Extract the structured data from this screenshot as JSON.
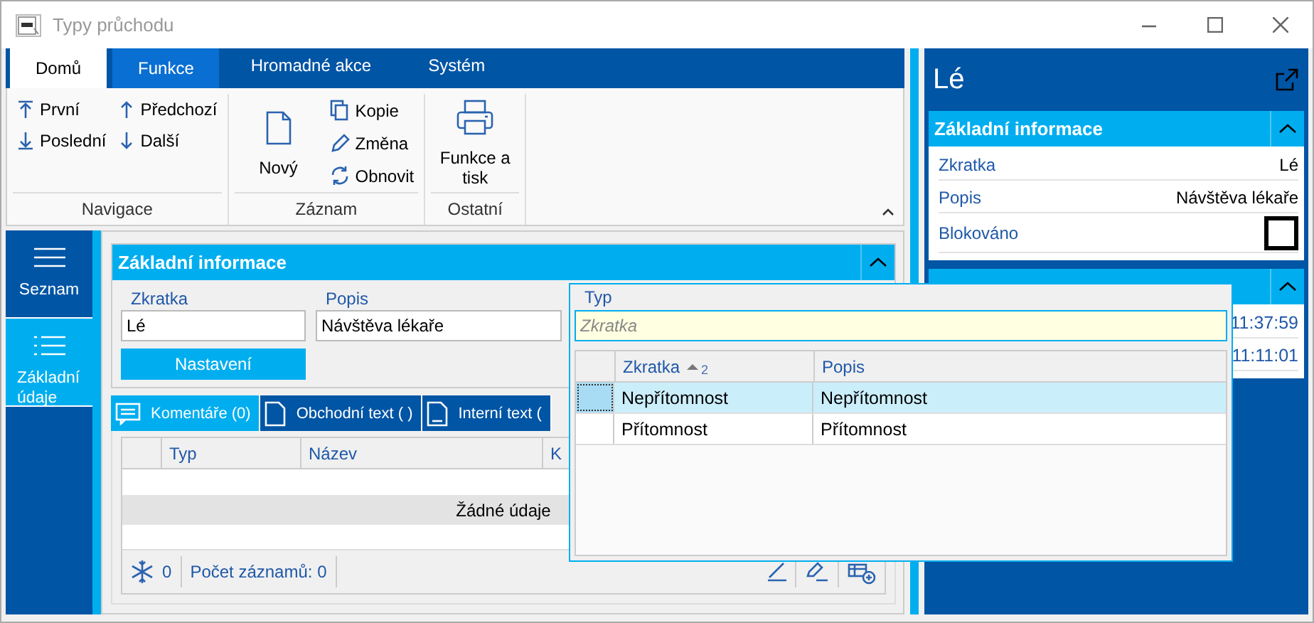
{
  "window": {
    "title": "Typy průchodu"
  },
  "ribbon": {
    "tabs": [
      {
        "label": "Domů",
        "selected": true,
        "kind": "normal"
      },
      {
        "label": "Funkce",
        "selected": false,
        "kind": "contextual"
      },
      {
        "label": "Hromadné akce",
        "selected": false,
        "kind": "normal"
      },
      {
        "label": "Systém",
        "selected": false,
        "kind": "normal"
      }
    ],
    "groups": [
      {
        "label": "Navigace",
        "items": [
          {
            "label": "První",
            "kind": "small"
          },
          {
            "label": "Poslední",
            "kind": "small"
          },
          {
            "label": "Předchozí",
            "kind": "small"
          },
          {
            "label": "Další",
            "kind": "small"
          }
        ]
      },
      {
        "label": "Záznam",
        "items": [
          {
            "label": "Nový",
            "kind": "large"
          },
          {
            "label": "Kopie",
            "kind": "small"
          },
          {
            "label": "Změna",
            "kind": "small"
          },
          {
            "label": "Obnovit",
            "kind": "small"
          }
        ]
      },
      {
        "label": "Ostatní",
        "items": [
          {
            "label": "Funkce a tisk",
            "kind": "large"
          }
        ]
      }
    ]
  },
  "sidebar": {
    "items": [
      {
        "label": "Seznam",
        "selected": false
      },
      {
        "label": "Základní údaje",
        "selected": true
      }
    ]
  },
  "form": {
    "title": "Základní informace",
    "fields": [
      {
        "label": "Zkratka",
        "value": "Lé"
      },
      {
        "label": "Popis",
        "value": "Návštěva lékaře"
      }
    ],
    "button": "Nastavení"
  },
  "subtabs": [
    {
      "label": "Komentáře (0)",
      "selected": true
    },
    {
      "label": "Obchodní text ( )",
      "selected": false
    },
    {
      "label": "Interní text (",
      "selected": false
    }
  ],
  "grid": {
    "columns": [
      "Typ",
      "Název",
      "K"
    ],
    "empty_text": "Žádné údaje",
    "footer": {
      "count": "0",
      "records": "Počet záznamů: 0"
    }
  },
  "detail_panel": {
    "title": "Lé",
    "cards": [
      {
        "title": "Základní informace",
        "rows": [
          {
            "kind": "text",
            "label": "Zkratka",
            "value": "Lé"
          },
          {
            "kind": "text",
            "label": "Popis",
            "value": "Návštěva lékaře"
          },
          {
            "kind": "checkbox",
            "label": "Blokováno",
            "checked": false
          }
        ]
      },
      {
        "rows": [
          {
            "kind": "time",
            "value": "11:37:59"
          },
          {
            "kind": "time",
            "value": "11:11:01"
          }
        ]
      }
    ]
  },
  "popup": {
    "label": "Typ",
    "search": {
      "placeholder": "Zkratka"
    },
    "columns": [
      {
        "label": "Zkratka",
        "sort_order": "2"
      },
      {
        "label": "Popis"
      }
    ],
    "rows": [
      {
        "cells": [
          "Nepřítomnost",
          "Nepřítomnost"
        ],
        "selected": true
      },
      {
        "cells": [
          "Přítomnost",
          "Přítomnost"
        ],
        "selected": false
      }
    ]
  }
}
